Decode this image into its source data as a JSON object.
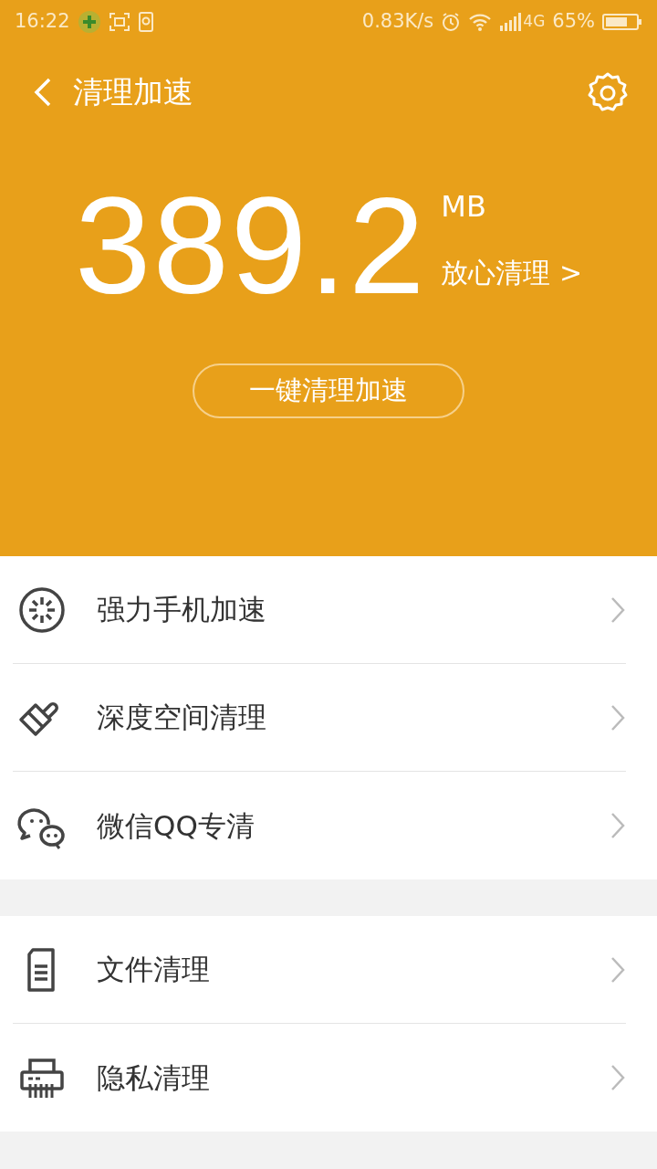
{
  "status_bar": {
    "time": "16:22",
    "speed": "0.83K/s",
    "network": "4G",
    "battery": "65%"
  },
  "header": {
    "title": "清理加速"
  },
  "summary": {
    "amount": "389.2",
    "unit": "MB",
    "link": "放心清理 >",
    "button": "一键清理加速"
  },
  "groups": [
    {
      "items": [
        {
          "kind": "boost",
          "label": "强力手机加速"
        },
        {
          "kind": "brush",
          "label": "深度空间清理"
        },
        {
          "kind": "chat",
          "label": "微信QQ专清"
        }
      ]
    },
    {
      "items": [
        {
          "kind": "file",
          "label": "文件清理"
        },
        {
          "kind": "shredder",
          "label": "隐私清理"
        }
      ]
    }
  ]
}
